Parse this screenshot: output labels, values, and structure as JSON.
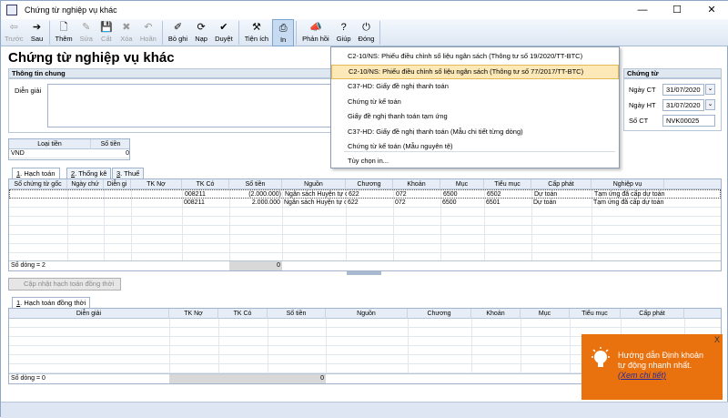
{
  "window": {
    "title": "Chứng từ nghiệp vụ khác",
    "min": "—",
    "max": "☐",
    "close": "✕"
  },
  "toolbar": [
    {
      "label": "Trước",
      "icon": "⇦",
      "disabled": true,
      "name": "prev-button"
    },
    {
      "label": "Sau",
      "icon": "➔",
      "disabled": false,
      "name": "next-button"
    },
    {
      "label": "Thêm",
      "icon": "🗋",
      "disabled": false,
      "name": "add-button"
    },
    {
      "label": "Sửa",
      "icon": "✎",
      "disabled": true,
      "name": "edit-button"
    },
    {
      "label": "Cất",
      "icon": "💾",
      "disabled": true,
      "name": "save-button"
    },
    {
      "label": "Xóa",
      "icon": "✖",
      "disabled": true,
      "name": "delete-button"
    },
    {
      "label": "Hoãn",
      "icon": "↶",
      "disabled": true,
      "name": "undo-button"
    },
    {
      "label": "Bỏ ghi",
      "icon": "✐",
      "disabled": false,
      "name": "unpost-button"
    },
    {
      "label": "Nạp",
      "icon": "⟳",
      "disabled": false,
      "name": "reload-button"
    },
    {
      "label": "Duyệt",
      "icon": "✔",
      "disabled": false,
      "name": "approve-button"
    },
    {
      "label": "Tiện ích",
      "icon": "⚒",
      "disabled": false,
      "name": "utilities-button"
    },
    {
      "label": "In",
      "icon": "⎙",
      "disabled": false,
      "name": "print-button",
      "active": true
    },
    {
      "label": "Phản hồi",
      "icon": "📣",
      "disabled": false,
      "name": "feedback-button"
    },
    {
      "label": "Giúp",
      "icon": "?",
      "disabled": false,
      "name": "help-button"
    },
    {
      "label": "Đóng",
      "icon": "⏻",
      "disabled": false,
      "name": "close-button"
    }
  ],
  "page_title": "Chứng từ nghiệp vụ khác",
  "general": {
    "header": "Thông tin chung",
    "desc_label": "Diễn giải",
    "desc_value": ""
  },
  "voucher": {
    "header": "Chứng từ",
    "date_ct_label": "Ngày CT",
    "date_ct": "31/07/2020",
    "date_ht_label": "Ngày HT",
    "date_ht": "31/07/2020",
    "no_label": "Số CT",
    "no": "NVK00025"
  },
  "currency": {
    "col1": "Loại tiền",
    "col2": "Số tiền",
    "type": "VND",
    "amount": "0"
  },
  "tabs": [
    {
      "key": "1",
      "label": ". Hạch toán"
    },
    {
      "key": "2",
      "label": ". Thống kê"
    },
    {
      "key": "3",
      "label": ". Thuế"
    }
  ],
  "grid1": {
    "headers": [
      "Số chứng từ gốc",
      "Ngày chứ",
      "Diễn gi",
      "TK Nợ",
      "TK Có",
      "Số tiền",
      "Nguồn",
      "Chương",
      "Khoản",
      "Mục",
      "Tiểu mục",
      "Cấp phát",
      "Nghiệp vụ"
    ],
    "rows": [
      [
        "",
        "",
        "",
        "",
        "008211",
        "(2.000.000)",
        "Ngân sách Huyện tự chủ",
        "622",
        "072",
        "6500",
        "6502",
        "Dự toán",
        "Tạm ứng đã cấp dự toán"
      ],
      [
        "",
        "",
        "",
        "",
        "008211",
        "2.000.000",
        "Ngân sách Huyện tự chủ",
        "622",
        "072",
        "6500",
        "6501",
        "Dự toán",
        "Tạm ứng đã cấp dự toán"
      ]
    ],
    "footer_label": "Số dòng = 2",
    "footer_total": "0"
  },
  "sync_button": "Cập nhật hạch toán đồng thời",
  "tab2": {
    "key": "1",
    "label": ". Hạch toán đồng thời"
  },
  "grid2": {
    "headers": [
      "Diễn giải",
      "TK Nợ",
      "TK Có",
      "Số tiền",
      "Nguồn",
      "Chương",
      "Khoản",
      "Mục",
      "Tiểu mục",
      "Cấp phát",
      "Ng"
    ],
    "footer_label": "Số dòng = 0",
    "footer_total": "0"
  },
  "print_menu": [
    {
      "label": "C2-10/NS: Phiếu điều chỉnh số liệu ngân sách (Thông tư số 19/2020/TT-BTC)"
    },
    {
      "label": "C2-10/NS: Phiếu điều chỉnh số liệu ngân sách (Thông tư số 77/2017/TT-BTC)",
      "highlight": true
    },
    {
      "label": "C37-HD: Giấy đề nghị thanh toán"
    },
    {
      "label": "Chứng từ kế toán"
    },
    {
      "label": "Giấy đề nghị thanh toán tạm ứng"
    },
    {
      "label": "C37-HD: Giấy đề nghị thanh toán (Mẫu chi tiết từng dòng)"
    },
    {
      "label": "Chứng từ kế toán (Mẫu nguyên tệ)"
    },
    {
      "label": "Tùy chọn in..."
    }
  ],
  "popup": {
    "line1": "Hướng dẫn Định khoản",
    "line2": "tự động nhanh nhất.",
    "link": "(Xem chi tiết)",
    "close": "X",
    "bg": "#e9720f"
  }
}
